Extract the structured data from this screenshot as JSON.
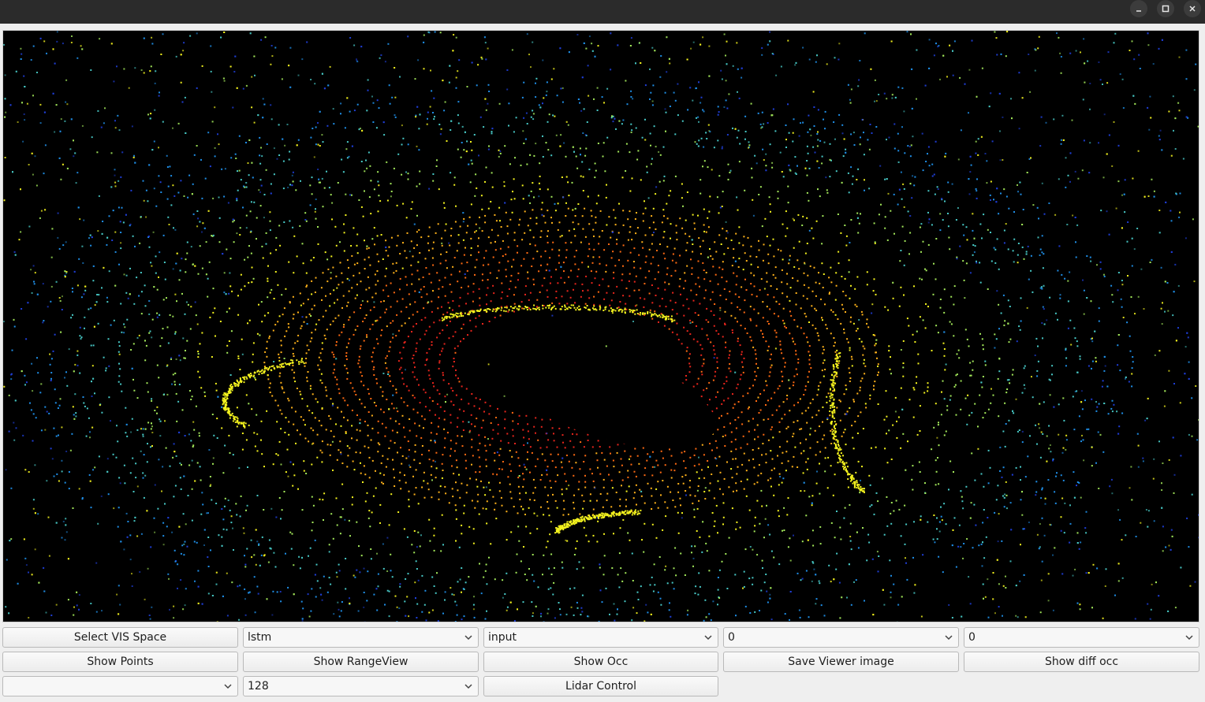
{
  "window": {
    "controls": [
      "minimize-icon",
      "maximize-icon",
      "close-icon"
    ]
  },
  "viewer": {
    "background": "#000000",
    "colormap": [
      "#e8251c",
      "#ff6a12",
      "#ffb21a",
      "#f4f31e",
      "#a3e85a",
      "#47c9c6",
      "#1f8ee6",
      "#1f3fd8"
    ]
  },
  "toolbar": {
    "row1": {
      "select_vis_space_label": "Select VIS Space",
      "model_combo_value": "lstm",
      "data_combo_value": "input",
      "combo_a_value": "0",
      "combo_b_value": "0"
    },
    "row2": {
      "show_points_label": "Show Points",
      "show_rangeview_label": "Show RangeView",
      "show_occ_label": "Show Occ",
      "save_viewer_image_label": "Save Viewer image",
      "show_diff_occ_label": "Show diff occ"
    },
    "row3": {
      "empty_combo_value": "",
      "beams_combo_value": "128",
      "lidar_control_label": "Lidar Control"
    }
  }
}
